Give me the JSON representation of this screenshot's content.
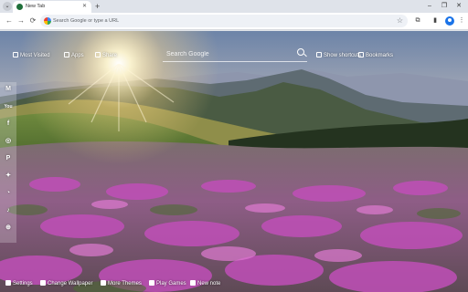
{
  "tab": {
    "title": "New Tab",
    "close_glyph": "✕"
  },
  "tabstrip": {
    "tab_search_glyph": "⌄",
    "new_tab_glyph": "+",
    "minimize_glyph": "–",
    "maximize_glyph": "❐",
    "close_glyph": "✕"
  },
  "toolbar": {
    "back_glyph": "←",
    "forward_glyph": "→",
    "reload_glyph": "⟳",
    "omnibox_placeholder": "Search Google or type a URL",
    "star_glyph": "☆",
    "extensions_glyph": "⧉",
    "sidepanel_glyph": "▮",
    "menu_glyph": "⋮"
  },
  "top_bar": {
    "most_visited": "Most Visited",
    "apps": "Apps",
    "share": "Share",
    "search_placeholder": "Search Google",
    "show_shortcuts": "Show shortcuts",
    "bookmarks": "Bookmarks"
  },
  "sidebar": {
    "items": [
      {
        "name": "gmail",
        "glyph": "M"
      },
      {
        "name": "youtube",
        "glyph": "You"
      },
      {
        "name": "facebook",
        "glyph": "f"
      },
      {
        "name": "instagram",
        "glyph": "◎"
      },
      {
        "name": "pinterest",
        "glyph": "P"
      },
      {
        "name": "twitter",
        "glyph": "✦"
      },
      {
        "name": "whatsapp",
        "glyph": "◔"
      },
      {
        "name": "tiktok",
        "glyph": "♪"
      },
      {
        "name": "more",
        "glyph": "⊕"
      }
    ]
  },
  "bottom_bar": {
    "settings": "Settings",
    "change_wallpaper": "Change Wallpaper",
    "more_themes": "More Themes",
    "play_games": "Play Games",
    "new_note": "New note"
  },
  "colors": {
    "accent": "#1a73e8",
    "tab_favicon": "#1f6f3a",
    "heather": "#c04fb8",
    "sky": "#7c93b8"
  }
}
